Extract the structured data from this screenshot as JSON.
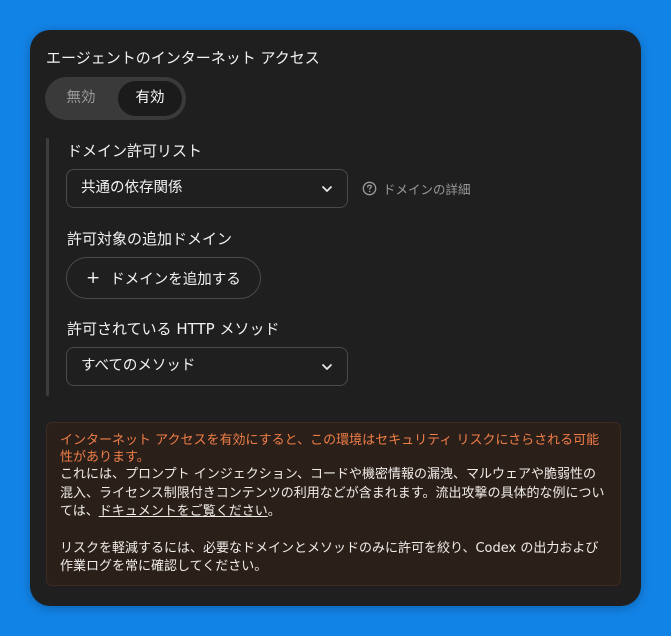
{
  "internet_access": {
    "title": "エージェントのインターネット アクセス",
    "toggle": {
      "off_label": "無効",
      "on_label": "有効",
      "selected": "有効"
    }
  },
  "domain_allowlist": {
    "label": "ドメイン許可リスト",
    "selected_value": "共通の依存関係",
    "help_link": "ドメインの詳細"
  },
  "additional_domains": {
    "label": "許可対象の追加ドメイン",
    "add_button_label": "ドメインを追加する"
  },
  "http_methods": {
    "label": "許可されている HTTP メソッド",
    "selected_value": "すべてのメソッド"
  },
  "warning": {
    "title": "インターネット アクセスを有効にすると、この環境はセキュリティ リスクにさらされる可能性があります。",
    "body_before_link": "これには、プロンプト インジェクション、コードや機密情報の漏洩、マルウェアや脆弱性の混入、ライセンス制限付きコンテンツの利用などが含まれます。流出攻撃の具体的な例については、",
    "link_text": "ドキュメントをご覧ください",
    "body_after_link": "。",
    "paragraph2": "リスクを軽減するには、必要なドメインとメソッドのみに許可を絞り、Codex の出力および作業ログを常に確認してください。"
  },
  "colors": {
    "background": "#1283e6",
    "panel": "#1f1f1f",
    "warning_title": "#f07e47",
    "warning_bg": "#2b1f1a"
  },
  "icons": {
    "select_chevron": "chevron-down-icon",
    "help": "question-circle-icon",
    "add": "plus-icon"
  }
}
